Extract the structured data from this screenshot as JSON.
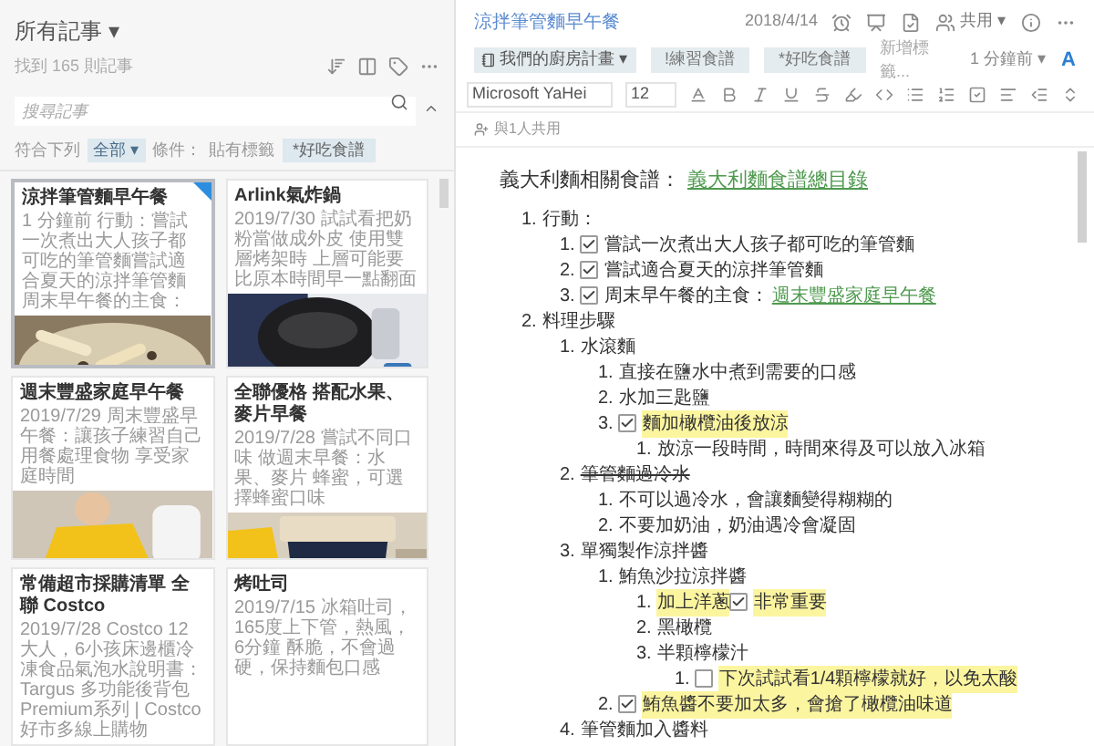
{
  "list_panel": {
    "title": "所有記事 ▾",
    "count": "找到 165 則記事",
    "search": {
      "placeholder": "搜尋記事"
    },
    "filter": {
      "label": "符合下列",
      "scope": "全部 ▾",
      "condition": "條件：",
      "tag_label": "貼有標籤",
      "tag": "*好吃食譜"
    },
    "cards": [
      {
        "title": "涼拌筆管麵早午餐",
        "body": "1 分鐘前 行動：嘗試一次煮出大人孩子都可吃的筆管麵嘗試適合夏天的涼拌筆管麵周末早午餐的主食：",
        "selected": true,
        "shortcut": true
      },
      {
        "title": "Arlink氣炸鍋",
        "body": "2019/7/30 試試看把奶粉當做成外皮 使用雙層烤架時 上層可能要比原本時間早一點翻面",
        "selected": false,
        "shortcut": false
      },
      {
        "title": "週末豐盛家庭早午餐",
        "body": "2019/7/29 周末豐盛早午餐：讓孩子練習自己用餐處理食物 享受家庭時間",
        "selected": false,
        "shortcut": false
      },
      {
        "title": "全聯優格 搭配水果、麥片早餐",
        "body": "2019/7/28 嘗試不同口味 做週末早餐：水果、麥片 蜂蜜，可選擇蜂蜜口味",
        "selected": false,
        "shortcut": false
      },
      {
        "title": "常備超市採購清單 全聯 Costco",
        "body": "2019/7/28 Costco 12大人，6小孩床邊櫃冷凍食品氣泡水說明書：Targus 多功能後背包 Premium系列 | Costco 好市多線上購物",
        "selected": false,
        "shortcut": false
      },
      {
        "title": "烤吐司",
        "body": "2019/7/15 冰箱吐司，165度上下管，熱風，6分鐘 酥脆，不會過硬，保持麵包口感",
        "selected": false,
        "shortcut": false
      }
    ]
  },
  "note": {
    "title": "涼拌筆管麵早午餐",
    "date": "2018/4/14",
    "share": "共用 ▾",
    "notebook": "我們的廚房計畫 ▾",
    "tags": [
      "!練習食譜",
      "*好吃食譜"
    ],
    "tag_placeholder": "新增標籤...",
    "updated": "1 分鐘前 ▾",
    "font_button": "A",
    "font": "Microsoft YaHei",
    "size": "12",
    "shared_with": "與1人共用",
    "heading": "義大利麵相關食譜：",
    "heading_link": "義大利麵食譜總目錄",
    "outline": [
      {
        "num": "1.",
        "kind": "text",
        "text": "行動：",
        "highlighted": false,
        "struck": false,
        "children": [
          {
            "num": "1.",
            "kind": "todo",
            "checked": true,
            "text": "嘗試一次煮出大人孩子都可吃的筆管麵",
            "highlighted": false,
            "struck": false
          },
          {
            "num": "2.",
            "kind": "todo",
            "checked": true,
            "text": "嘗試適合夏天的涼拌筆管麵",
            "highlighted": false,
            "struck": false
          },
          {
            "num": "3.",
            "kind": "todo",
            "checked": true,
            "text": "周末早午餐的主食：",
            "link": "週末豐盛家庭早午餐",
            "highlighted": false,
            "struck": false
          }
        ]
      },
      {
        "num": "2.",
        "kind": "text",
        "text": "料理步驟",
        "highlighted": false,
        "struck": false,
        "children": [
          {
            "num": "1.",
            "kind": "text",
            "text": "水滾麵",
            "highlighted": false,
            "struck": false,
            "children": [
              {
                "num": "1.",
                "kind": "text",
                "text": "直接在鹽水中煮到需要的口感",
                "highlighted": false,
                "struck": false
              },
              {
                "num": "2.",
                "kind": "text",
                "text": "水加三匙鹽",
                "highlighted": false,
                "struck": false
              },
              {
                "num": "3.",
                "kind": "todo",
                "checked": true,
                "text": "麵加橄欖油後放涼",
                "highlighted": true,
                "struck": false,
                "children": [
                  {
                    "num": "1.",
                    "kind": "text",
                    "text": "放涼一段時間，時間來得及可以放入冰箱",
                    "highlighted": false,
                    "struck": false
                  }
                ]
              }
            ]
          },
          {
            "num": "2.",
            "kind": "text",
            "text": "筆管麵過冷水",
            "highlighted": false,
            "struck": true,
            "children": [
              {
                "num": "1.",
                "kind": "text",
                "text": "不可以過冷水，會讓麵變得糊糊的",
                "highlighted": false,
                "struck": false
              },
              {
                "num": "2.",
                "kind": "text",
                "text": "不要加奶油，奶油遇冷會凝固",
                "highlighted": false,
                "struck": false
              }
            ]
          },
          {
            "num": "3.",
            "kind": "text",
            "text": "單獨製作涼拌醬",
            "highlighted": false,
            "struck": false,
            "children": [
              {
                "num": "1.",
                "kind": "text",
                "text": "鮪魚沙拉涼拌醬",
                "highlighted": false,
                "struck": false,
                "children": [
                  {
                    "num": "1.",
                    "kind": "inline_todo",
                    "text": "加上洋蔥",
                    "checked": true,
                    "after": "非常重要",
                    "highlighted": true,
                    "struck": false
                  },
                  {
                    "num": "2.",
                    "kind": "text",
                    "text": "黑橄欖",
                    "highlighted": false,
                    "struck": false
                  },
                  {
                    "num": "3.",
                    "kind": "text",
                    "text": "半顆檸檬汁",
                    "highlighted": false,
                    "struck": false,
                    "children": [
                      {
                        "num": "1.",
                        "kind": "todo",
                        "checked": false,
                        "text": "下次試試看1/4顆檸檬就好，以免太酸",
                        "highlighted": true,
                        "struck": false
                      }
                    ]
                  }
                ]
              },
              {
                "num": "2.",
                "kind": "todo",
                "checked": true,
                "text": "鮪魚醬不要加太多，會搶了橄欖油味道",
                "highlighted": true,
                "struck": false
              }
            ]
          },
          {
            "num": "4.",
            "kind": "text",
            "text": "筆管麵加入醬料",
            "highlighted": false,
            "struck": false
          }
        ]
      }
    ]
  }
}
